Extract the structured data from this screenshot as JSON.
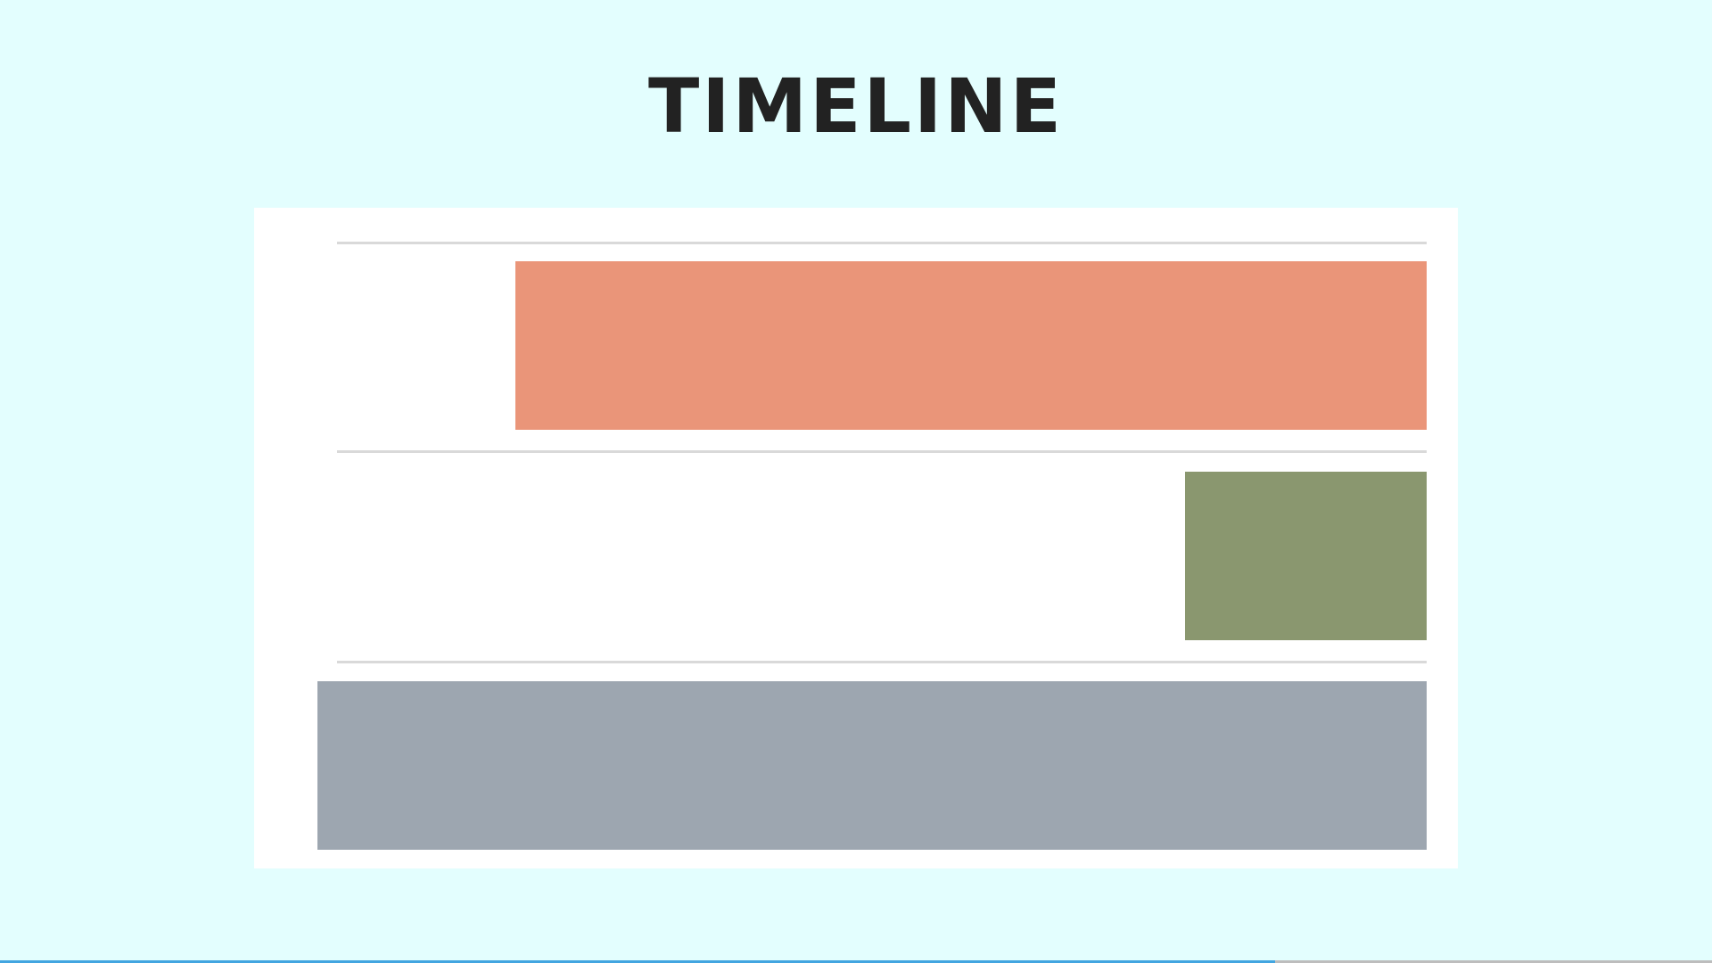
{
  "slide": {
    "title": "TIMELINE"
  },
  "colors": {
    "background": "#e3fefe",
    "panel": "#ffffff",
    "rule": "#d9d9d9",
    "progress_fill": "#42a5e0",
    "progress_track": "#bdbdbd"
  },
  "progress": {
    "fraction": 0.745
  },
  "timeline_bars": [
    {
      "color": "#ea9579",
      "start_fraction": 0.164,
      "end_fraction": 1.0
    },
    {
      "color": "#8a976f",
      "start_fraction": 0.778,
      "end_fraction": 1.0
    },
    {
      "color": "#9da6b0",
      "start_fraction": -0.018,
      "end_fraction": 1.0
    }
  ]
}
